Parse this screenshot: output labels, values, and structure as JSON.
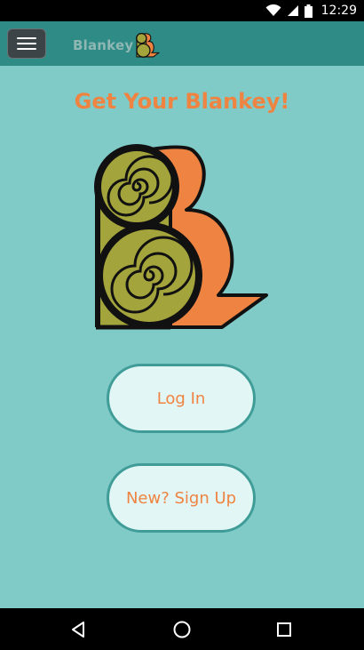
{
  "status_bar": {
    "time": "12:29",
    "icons": [
      "wifi-icon",
      "signal-icon",
      "battery-icon"
    ]
  },
  "toolbar": {
    "menu_icon": "hamburger-menu-icon",
    "brand_name": "Blankey"
  },
  "main": {
    "heading": "Get Your Blankey!",
    "login_label": "Log In",
    "signup_label": "New? Sign Up"
  },
  "nav_bar": {
    "buttons": [
      "back-icon",
      "home-icon",
      "recents-icon"
    ]
  },
  "colors": {
    "background": "#80cbc8",
    "toolbar": "#2e8b86",
    "accent_orange": "#ef8341",
    "roll_olive": "#a4a43c",
    "button_fill": "#e3f6f6",
    "button_border": "#3f9c97"
  }
}
